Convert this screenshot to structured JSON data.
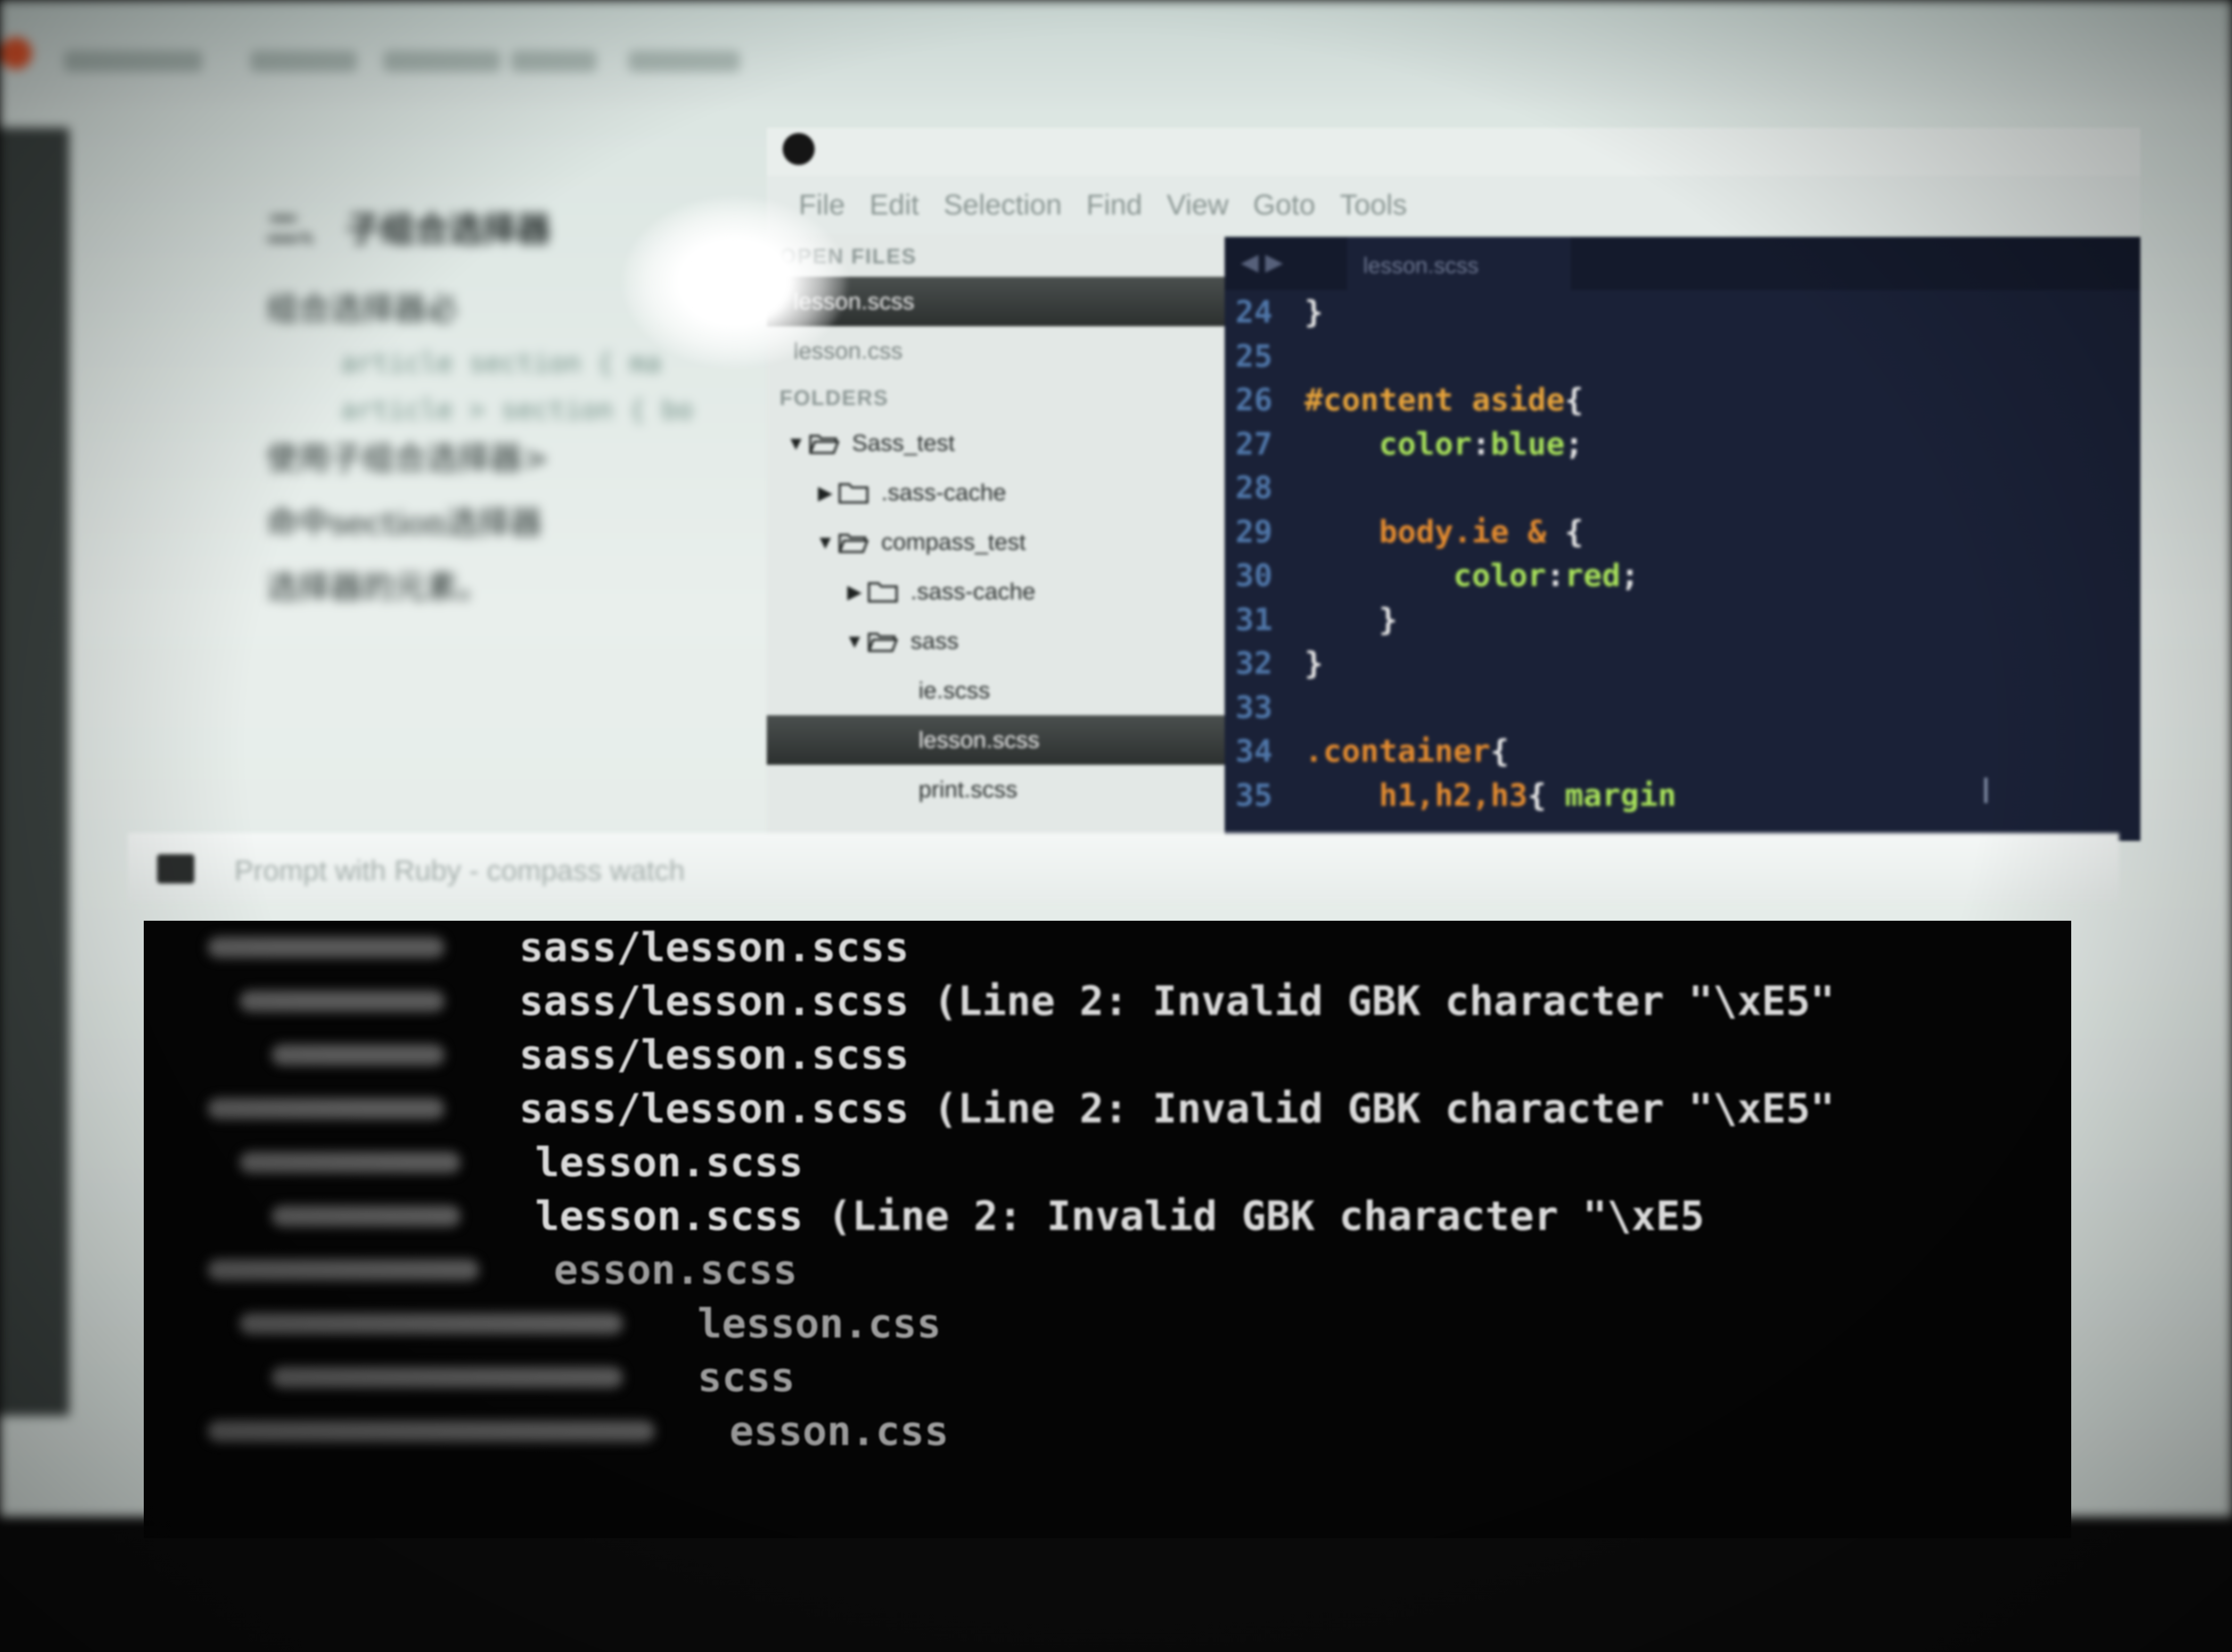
{
  "browser": {
    "heading": "二、 子组合选择器",
    "paragraphs": [
      "组合选择器必",
      "使用子组合选择器>",
      "命中section选择器",
      "选择器的元素。"
    ],
    "code_lines": [
      "article section { ma",
      "article > section { bo"
    ]
  },
  "sublime": {
    "menu": [
      "File",
      "Edit",
      "Selection",
      "Find",
      "View",
      "Goto",
      "Tools"
    ],
    "sidebar": {
      "open_files_header": "OPEN FILES",
      "folders_header": "FOLDERS",
      "open_files": [
        {
          "label": "lesson.scss",
          "selected": true
        },
        {
          "label": "lesson.css",
          "selected": false
        }
      ],
      "tree": [
        {
          "label": "Sass_test",
          "arrow": "▼",
          "icon": "folder-open-icon",
          "depth": 0
        },
        {
          "label": ".sass-cache",
          "arrow": "▶",
          "icon": "folder-icon",
          "depth": 1
        },
        {
          "label": "compass_test",
          "arrow": "▼",
          "icon": "folder-open-icon",
          "depth": 1
        },
        {
          "label": ".sass-cache",
          "arrow": "▶",
          "icon": "folder-icon",
          "depth": 2
        },
        {
          "label": "sass",
          "arrow": "▼",
          "icon": "folder-open-icon",
          "depth": 2
        },
        {
          "label": "ie.scss",
          "arrow": "",
          "icon": "",
          "depth": 3
        },
        {
          "label": "lesson.scss",
          "arrow": "",
          "icon": "",
          "depth": 3,
          "selected": true
        },
        {
          "label": "print.scss",
          "arrow": "",
          "icon": "",
          "depth": 3
        }
      ]
    },
    "editor": {
      "tab_label": "lesson.scss",
      "nav_arrows": "◀ ▶",
      "lines": [
        {
          "n": "24",
          "tokens": [
            {
              "t": "}",
              "c": "punc"
            }
          ]
        },
        {
          "n": "25",
          "tokens": []
        },
        {
          "n": "26",
          "tokens": [
            {
              "t": "#content aside",
              "c": "id"
            },
            {
              "t": "{",
              "c": "punc"
            }
          ]
        },
        {
          "n": "27",
          "tokens": [
            {
              "t": "    ",
              "c": "punc"
            },
            {
              "t": "color",
              "c": "prop"
            },
            {
              "t": ":",
              "c": "punc"
            },
            {
              "t": "blue",
              "c": "prop"
            },
            {
              "t": ";",
              "c": "punc"
            }
          ]
        },
        {
          "n": "28",
          "tokens": []
        },
        {
          "n": "29",
          "tokens": [
            {
              "t": "    ",
              "c": "punc"
            },
            {
              "t": "body.ie &",
              "c": "sel"
            },
            {
              "t": " {",
              "c": "punc"
            }
          ]
        },
        {
          "n": "30",
          "tokens": [
            {
              "t": "        ",
              "c": "punc"
            },
            {
              "t": "color",
              "c": "prop"
            },
            {
              "t": ":",
              "c": "punc"
            },
            {
              "t": "red",
              "c": "prop"
            },
            {
              "t": ";",
              "c": "punc"
            }
          ]
        },
        {
          "n": "31",
          "tokens": [
            {
              "t": "    }",
              "c": "punc"
            }
          ]
        },
        {
          "n": "32",
          "tokens": [
            {
              "t": "}",
              "c": "punc"
            }
          ]
        },
        {
          "n": "33",
          "tokens": []
        },
        {
          "n": "34",
          "tokens": [
            {
              "t": ".container",
              "c": "sel"
            },
            {
              "t": "{",
              "c": "punc"
            }
          ]
        },
        {
          "n": "35",
          "tokens": [
            {
              "t": "    ",
              "c": "punc"
            },
            {
              "t": "h1,h2,h3",
              "c": "sel"
            },
            {
              "t": "{ ",
              "c": "punc"
            },
            {
              "t": "margin",
              "c": "prop"
            }
          ]
        }
      ]
    }
  },
  "cmd": {
    "title": "Prompt with Ruby - compass  watch",
    "lines": [
      {
        "prefix": "",
        "file": "sass/lesson.scss",
        "error": ""
      },
      {
        "prefix": "",
        "file": "sass/lesson.scss",
        "error": "(Line 2: Invalid GBK character \"\\xE5\""
      },
      {
        "prefix": "",
        "file": "sass/lesson.scss",
        "error": ""
      },
      {
        "prefix": "",
        "file": "sass/lesson.scss",
        "error": "(Line 2: Invalid GBK character \"\\xE5\""
      },
      {
        "prefix": "",
        "file": "lesson.scss",
        "error": ""
      },
      {
        "prefix": "",
        "file": "lesson.scss",
        "error": "(Line 2: Invalid GBK character \"\\xE5"
      },
      {
        "prefix": "",
        "file": "esson.scss",
        "error": ""
      },
      {
        "prefix": "",
        "file": "lesson.css",
        "error": ""
      },
      {
        "prefix": "",
        "file": "scss",
        "error": ""
      },
      {
        "prefix": "",
        "file": "esson.css",
        "error": ""
      }
    ]
  }
}
